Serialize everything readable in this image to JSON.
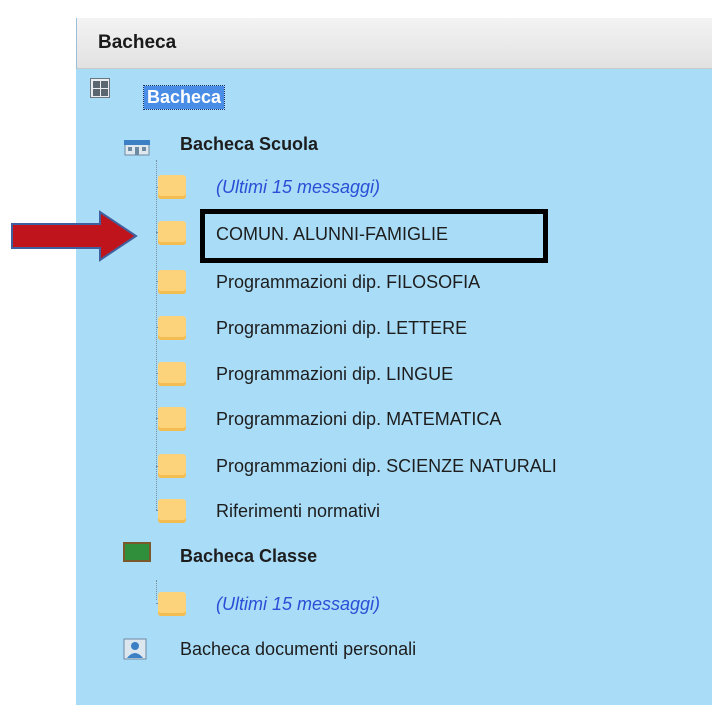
{
  "panel": {
    "title": "Bacheca"
  },
  "tree": {
    "root_label": "Bacheca",
    "school": {
      "label": "Bacheca Scuola",
      "items": [
        "(Ultimi 15 messaggi)",
        "COMUN. ALUNNI-FAMIGLIE",
        "Programmazioni dip. FILOSOFIA",
        "Programmazioni dip. LETTERE",
        "Programmazioni dip. LINGUE",
        "Programmazioni dip. MATEMATICA",
        "Programmazioni dip. SCIENZE NATURALI",
        "Riferimenti normativi"
      ]
    },
    "class": {
      "label": "Bacheca Classe",
      "items": [
        "(Ultimi 15 messaggi)"
      ]
    },
    "personal_label": "Bacheca documenti personali"
  },
  "colors": {
    "panel_bg": "#a9dcf7",
    "selected_bg": "#4a8de6",
    "folder": "#fcd27a",
    "arrow": "#c0141c",
    "highlight_border": "#000000"
  }
}
